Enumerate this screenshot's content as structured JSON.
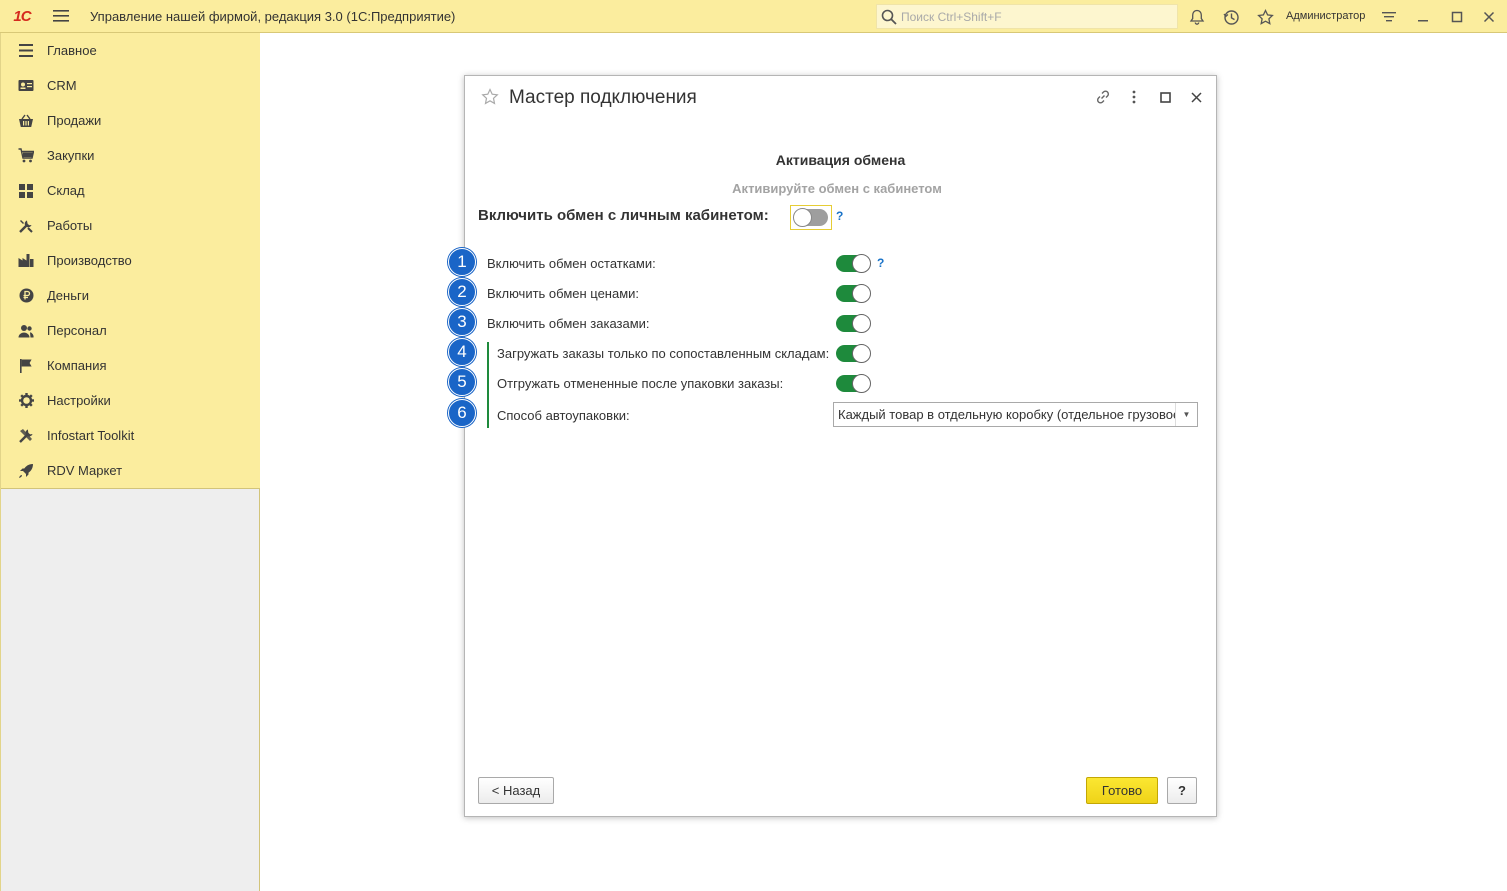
{
  "window": {
    "logo_text": "1С",
    "title": "Управление нашей фирмой, редакция 3.0  (1С:Предприятие)",
    "search_placeholder": "Поиск Ctrl+Shift+F",
    "user": "Администратор"
  },
  "sidebar": {
    "items": [
      {
        "label": "Главное",
        "icon": "list-icon"
      },
      {
        "label": "CRM",
        "icon": "contact-card-icon"
      },
      {
        "label": "Продажи",
        "icon": "basket-icon"
      },
      {
        "label": "Закупки",
        "icon": "cart-icon"
      },
      {
        "label": "Склад",
        "icon": "grid-icon"
      },
      {
        "label": "Работы",
        "icon": "tools-icon"
      },
      {
        "label": "Производство",
        "icon": "factory-icon"
      },
      {
        "label": "Деньги",
        "icon": "ruble-icon"
      },
      {
        "label": "Персонал",
        "icon": "people-icon"
      },
      {
        "label": "Компания",
        "icon": "flag-icon"
      },
      {
        "label": "Настройки",
        "icon": "gear-icon"
      },
      {
        "label": "Infostart Toolkit",
        "icon": "wrench-icon"
      },
      {
        "label": "RDV Маркет",
        "icon": "rocket-icon"
      }
    ]
  },
  "dialog": {
    "title": "Мастер подключения",
    "section_title": "Активация обмена",
    "section_subtitle": "Активируйте обмен с кабинетом",
    "main_toggle": {
      "label": "Включить обмен с личным кабинетом:",
      "on": false,
      "help": "?"
    },
    "rows": [
      {
        "num": "1",
        "label": "Включить обмен остатками:",
        "on": true,
        "help": "?"
      },
      {
        "num": "2",
        "label": "Включить обмен ценами:",
        "on": true
      },
      {
        "num": "3",
        "label": "Включить обмен заказами:",
        "on": true
      },
      {
        "num": "4",
        "label": "Загружать заказы только по сопоставленным складам:",
        "on": true
      },
      {
        "num": "5",
        "label": "Отгружать отмененные после упаковки заказы:",
        "on": true
      },
      {
        "num": "6",
        "label": "Способ автоупаковки:",
        "value": "Каждый товар в отдельную коробку (отдельное грузовое место)"
      }
    ],
    "buttons": {
      "back": "< Назад",
      "done": "Готово",
      "help": "?"
    }
  },
  "colors": {
    "accent_yellow": "#fbed9e",
    "toggle_on": "#1e8a3c",
    "badge_blue": "#1a65c7"
  }
}
